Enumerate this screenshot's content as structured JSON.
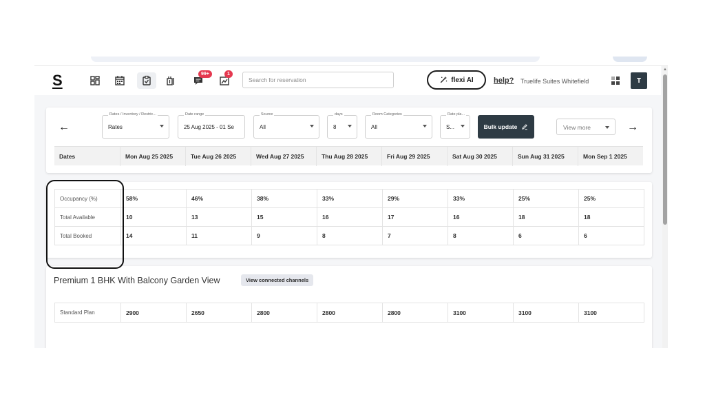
{
  "header": {
    "logo": "S",
    "icons": [
      "dashboard-icon",
      "calendar-icon",
      "clipboard-check-icon",
      "luggage-icon",
      "chat-icon",
      "chart-icon"
    ],
    "badges": {
      "chat": "99+",
      "chart": "1"
    },
    "search_placeholder": "Search for reservation",
    "flexi_label": "flexi AI",
    "help_label": "help?",
    "hotel_name": "Truelife Suites Whitefield",
    "avatar_letter": "T"
  },
  "filters": {
    "rates_label": "Rates / Inventory / Restric...",
    "rates_value": "Rates",
    "date_label": "Date range",
    "date_value": "25 Aug 2025 - 01 Se",
    "source_label": "Source",
    "source_value": "All",
    "days_label": "days",
    "days_value": "8",
    "room_label": "Room Categories",
    "room_value": "All",
    "plan_label": "Rate pla...",
    "plan_value": "S...",
    "bulk_label": "Bulk update",
    "view_more": "View more"
  },
  "dates": {
    "header": "Dates",
    "days": [
      "Mon Aug 25 2025",
      "Tue Aug 26 2025",
      "Wed Aug 27 2025",
      "Thu Aug 28 2025",
      "Fri Aug 29 2025",
      "Sat Aug 30 2025",
      "Sun Aug 31 2025",
      "Mon Sep 1 2025"
    ]
  },
  "stats": {
    "rows": [
      {
        "label": "Occupancy (%)",
        "values": [
          "58%",
          "46%",
          "38%",
          "33%",
          "29%",
          "33%",
          "25%",
          "25%"
        ]
      },
      {
        "label": "Total Available",
        "values": [
          "10",
          "13",
          "15",
          "16",
          "17",
          "16",
          "18",
          "18"
        ]
      },
      {
        "label": "Total Booked",
        "values": [
          "14",
          "11",
          "9",
          "8",
          "7",
          "8",
          "6",
          "6"
        ]
      }
    ]
  },
  "room": {
    "title": "Premium 1 BHK With Balcony Garden View",
    "channels_button": "View connected channels",
    "plans": [
      {
        "label": "Standard Plan",
        "values": [
          "2900",
          "2650",
          "2800",
          "2800",
          "2800",
          "3100",
          "3100",
          "3100"
        ]
      }
    ]
  }
}
